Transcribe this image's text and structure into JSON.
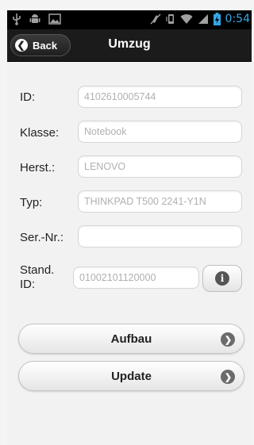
{
  "status_bar": {
    "time": "0:54"
  },
  "header": {
    "back_label": "Back",
    "title": "Umzug"
  },
  "form": {
    "id": {
      "label": "ID:",
      "value": "4102610005744"
    },
    "klasse": {
      "label": "Klasse:",
      "value": "Notebook"
    },
    "herst": {
      "label": "Herst.:",
      "value": "LENOVO"
    },
    "typ": {
      "label": "Typ:",
      "value": "THINKPAD T500 2241-Y1N"
    },
    "sernr": {
      "label": "Ser.-Nr.:",
      "value": ""
    },
    "stand_id": {
      "label_line1": "Stand.",
      "label_line2": "ID:",
      "value": "01002101120000"
    }
  },
  "buttons": {
    "aufbau": "Aufbau",
    "update": "Update"
  },
  "icons": {
    "usb": "usb-icon",
    "android": "android-debug-icon",
    "image": "image-icon",
    "mute": "mute-icon",
    "vibrate": "vibrate-icon",
    "wifi": "wifi-icon",
    "signal": "signal-icon",
    "battery": "battery-charging-icon",
    "back": "chevron-left-icon",
    "info": "info-icon",
    "arrow": "chevron-right-icon"
  },
  "colors": {
    "time": "#36a6e6",
    "battery": "#36a6e6",
    "header_bg": "#1b1b1b",
    "content_bg": "#f2f2f2"
  }
}
